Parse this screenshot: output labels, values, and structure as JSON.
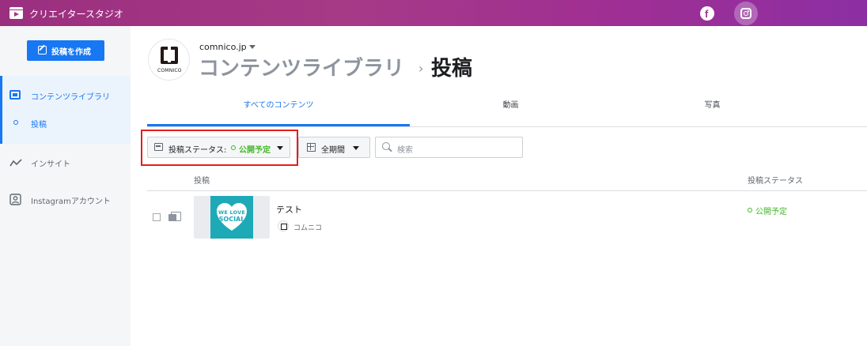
{
  "app": {
    "title": "クリエイタースタジオ",
    "icon": "clapperboard-icon",
    "header_icons": [
      "facebook-icon",
      "instagram-icon"
    ],
    "brand_color": "#a63a87"
  },
  "sidebar": {
    "create_button": "投稿を作成",
    "items": [
      {
        "label": "コンテンツライブラリ",
        "icon": "content-library-icon",
        "active": true
      },
      {
        "label": "投稿",
        "icon": "dot-icon",
        "active": true
      },
      {
        "label": "インサイト",
        "icon": "insights-icon",
        "active": false
      },
      {
        "label": "Instagramアカウント",
        "icon": "account-icon",
        "active": false
      }
    ]
  },
  "main": {
    "account_name": "comnico.jp",
    "avatar_text": "COMNICO",
    "breadcrumb": {
      "parent": "コンテンツライブラリ",
      "separator": "›",
      "current": "投稿"
    },
    "tabs": [
      {
        "label": "すべてのコンテンツ",
        "active": true
      },
      {
        "label": "動画",
        "active": false
      },
      {
        "label": "写真",
        "active": false
      }
    ],
    "filters": {
      "status_label": "投稿ステータス:",
      "status_value": "公開予定",
      "period_label": "全期間",
      "search_placeholder": "検索"
    },
    "table": {
      "columns": [
        "投稿",
        "投稿ステータス"
      ],
      "rows": [
        {
          "title": "テスト",
          "author": "コムニコ",
          "status": "公開予定",
          "thumbnail_line1": "WE LOVE",
          "thumbnail_line2": "SOCIAL"
        }
      ]
    },
    "accent_color": "#1877f2",
    "status_color": "#42b72a",
    "highlight_color": "#e0201b"
  }
}
